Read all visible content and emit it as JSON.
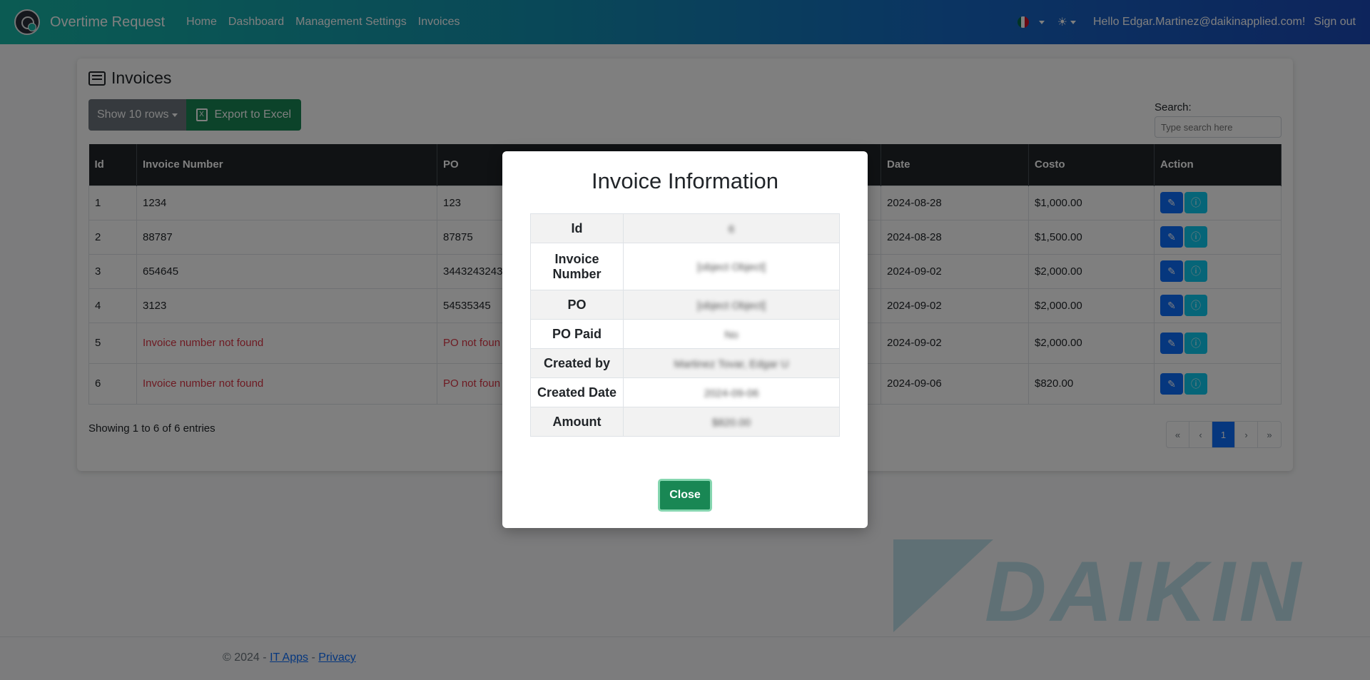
{
  "navbar": {
    "brand": "Overtime Request",
    "links": [
      "Home",
      "Dashboard",
      "Management Settings",
      "Invoices"
    ],
    "hello": "Hello Edgar.Martinez@daikinapplied.com!",
    "signout": "Sign out"
  },
  "page": {
    "title": "Invoices",
    "show_rows": "Show 10 rows",
    "export": "Export to Excel",
    "search_label": "Search:",
    "search_placeholder": "Type search here",
    "showing": "Showing 1 to 6 of 6 entries"
  },
  "table": {
    "headers": [
      "Id",
      "Invoice Number",
      "PO",
      "Date",
      "Costo",
      "Action"
    ],
    "rows": [
      {
        "id": "1",
        "invoice": "1234",
        "po": "123",
        "date": "2024-08-28",
        "cost": "$1,000.00"
      },
      {
        "id": "2",
        "invoice": "88787",
        "po": "87875",
        "date": "2024-08-28",
        "cost": "$1,500.00"
      },
      {
        "id": "3",
        "invoice": "654645",
        "po": "3443243243",
        "date": "2024-09-02",
        "cost": "$2,000.00"
      },
      {
        "id": "4",
        "invoice": "3123",
        "po": "54535345",
        "date": "2024-09-02",
        "cost": "$2,000.00"
      },
      {
        "id": "5",
        "invoice": "Invoice number not found",
        "po": "PO not foun",
        "date": "2024-09-02",
        "cost": "$2,000.00"
      },
      {
        "id": "6",
        "invoice": "Invoice number not found",
        "po": "PO not foun",
        "date": "2024-09-06",
        "cost": "$820.00"
      }
    ]
  },
  "pagination": {
    "first": "«",
    "prev": "‹",
    "current": "1",
    "next": "›",
    "last": "»"
  },
  "modal": {
    "title": "Invoice Information",
    "fields": [
      {
        "label": "Id",
        "value": "6"
      },
      {
        "label": "Invoice Number",
        "value": "[object Object]"
      },
      {
        "label": "PO",
        "value": "[object Object]"
      },
      {
        "label": "PO Paid",
        "value": "No"
      },
      {
        "label": "Created by",
        "value": "Martinez Tovar, Edgar U"
      },
      {
        "label": "Created Date",
        "value": "2024-09-06"
      },
      {
        "label": "Amount",
        "value": "$820.00"
      }
    ],
    "close": "Close"
  },
  "footer": {
    "copyright": "© 2024 -",
    "link1": "IT Apps",
    "sep": "-",
    "link2": "Privacy"
  },
  "watermark": {
    "text": "DAIKIN"
  },
  "colors": {
    "primary": "#0d6efd",
    "success": "#198754",
    "danger": "#dc3545",
    "info": "#0dcaf0"
  }
}
